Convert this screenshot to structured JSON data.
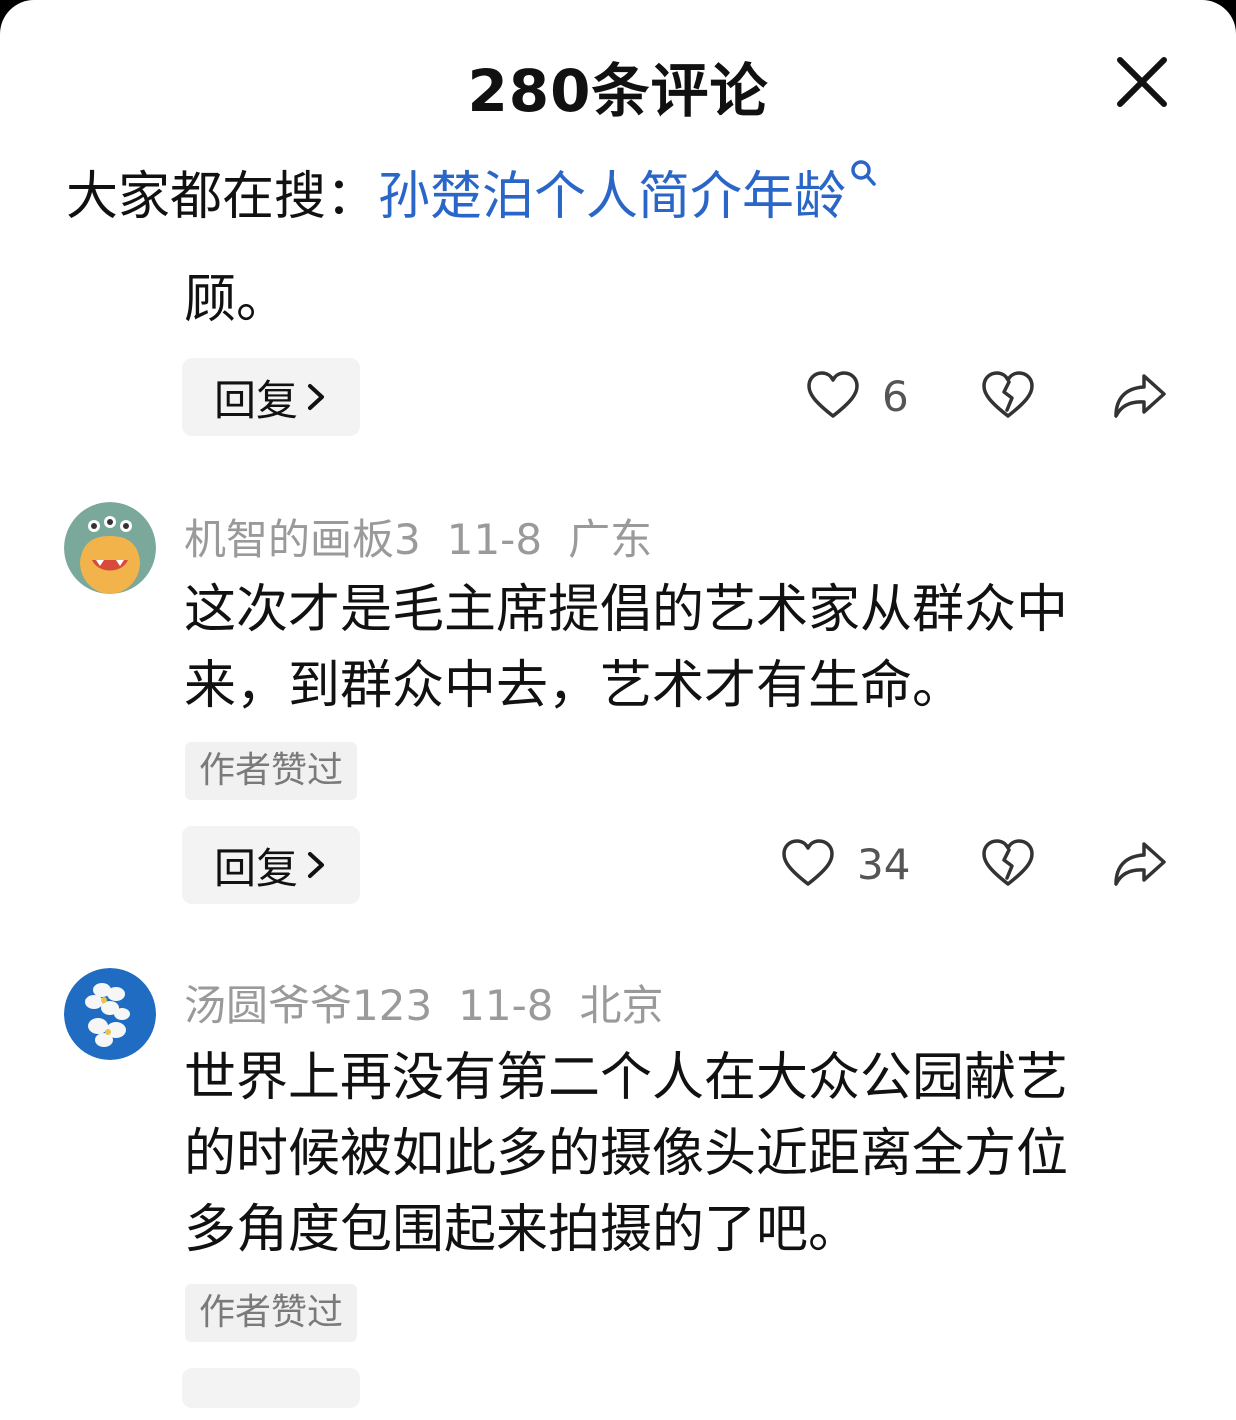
{
  "header": {
    "title": "280条评论"
  },
  "search": {
    "prefix": "大家都在搜：",
    "query": "孙楚泊个人简介年龄"
  },
  "comments": [
    {
      "text_lines": [
        "顾。"
      ],
      "reply_label": "回复",
      "likes": "6"
    },
    {
      "username": "机智的画板3",
      "date": "11-8",
      "location": "广东",
      "text_lines": [
        "这次才是毛主席提倡的艺术家从群众中",
        "来，到群众中去，艺术才有生命。"
      ],
      "badge": "作者赞过",
      "reply_label": "回复",
      "likes": "34"
    },
    {
      "username": "汤圆爷爷123",
      "date": "11-8",
      "location": "北京",
      "text_lines": [
        "世界上再没有第二个人在大众公园献艺",
        "的时候被如此多的摄像头近距离全方位",
        "多角度包围起来拍摄的了吧。"
      ],
      "badge": "作者赞过"
    }
  ],
  "icons": {
    "close": "close-icon",
    "search": "search-icon",
    "like": "heart-icon",
    "dislike": "broken-heart-icon",
    "share": "share-arrow-icon",
    "chevron": "chevron-right-icon"
  },
  "colors": {
    "link": "#2a66c8",
    "meta": "#9a9a9a",
    "badge_bg": "#f1f1f1"
  }
}
